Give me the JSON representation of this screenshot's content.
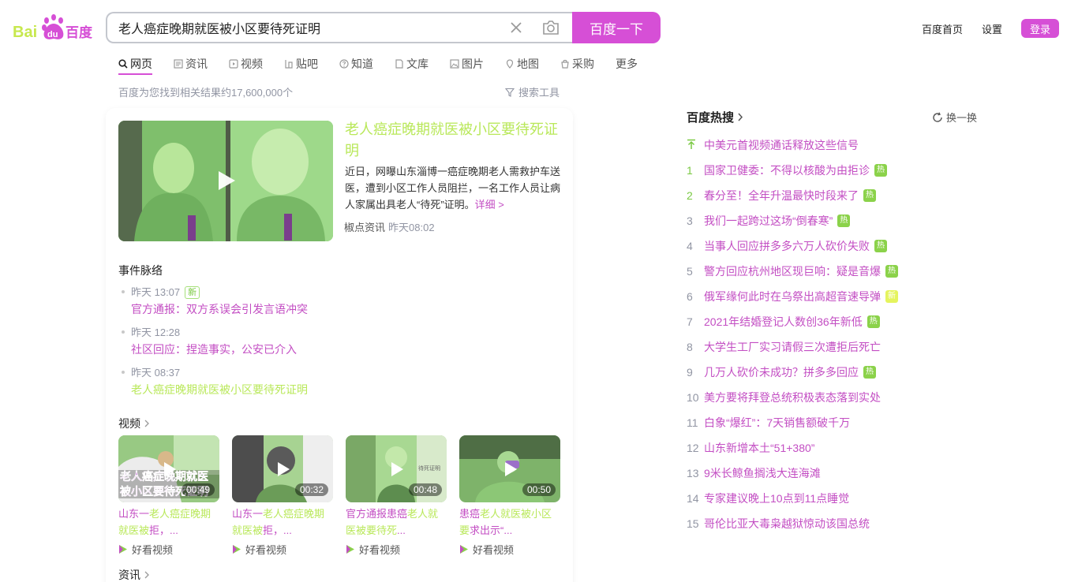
{
  "header": {
    "logo_text": "Bai du 百度",
    "search_value": "老人癌症晚期就医被小区要待死证明",
    "search_button": "百度一下",
    "links": [
      "百度首页",
      "设置"
    ],
    "login": "登录",
    "accent_color": "#d64fd6"
  },
  "tabs": [
    {
      "label": "网页",
      "icon": "search-icon"
    },
    {
      "label": "资讯",
      "icon": "news-icon"
    },
    {
      "label": "视频",
      "icon": "video-icon"
    },
    {
      "label": "贴吧",
      "icon": "tieba-icon"
    },
    {
      "label": "知道",
      "icon": "question-icon"
    },
    {
      "label": "文库",
      "icon": "document-icon"
    },
    {
      "label": "图片",
      "icon": "image-icon"
    },
    {
      "label": "地图",
      "icon": "map-icon"
    },
    {
      "label": "采购",
      "icon": "shopping-icon"
    },
    {
      "label": "更多",
      "icon": ""
    }
  ],
  "result_count": "百度为您找到相关结果约17,600,000个",
  "search_tools": "搜索工具",
  "news": {
    "title": "老人癌症晚期就医被小区要待死证明",
    "summary": "近日，网曝山东淄博一癌症晚期老人需救护车送医，遭到小区工作人员阻拦，一名工作人员让病人家属出具老人“待死”证明。",
    "more": "详细 >",
    "source": "椒点资讯",
    "time": "昨天08:02"
  },
  "timeline": {
    "title": "事件脉络",
    "items": [
      {
        "time": "昨天 13:07",
        "badge": "新",
        "text": "官方通报：双方系误会引发言语冲突"
      },
      {
        "time": "昨天 12:28",
        "badge": "",
        "text": "社区回应：捏造事实，公安已介入"
      },
      {
        "time": "昨天 08:37",
        "badge": "",
        "text": "老人癌症晚期就医被小区要待死证明"
      }
    ]
  },
  "videos": {
    "title": "视频",
    "items": [
      {
        "duration": "00:49",
        "t1": "山东一",
        "t2": "老人癌症晚期就医被",
        "t3": "拒，...",
        "source": "好看视频",
        "overlay": "老人癌症晚期就医被小区要待死证明"
      },
      {
        "duration": "00:32",
        "t1": "山东一",
        "t2": "老人癌症晚期就医被",
        "t3": "拒，...",
        "source": "好看视频"
      },
      {
        "duration": "00:48",
        "t1": "官方通报患癌",
        "t2": "老人就医被要待死",
        "t3": "...",
        "source": "好看视频"
      },
      {
        "duration": "00:50",
        "t1": "患癌",
        "t2": "老人就医被小区要",
        "t3": "求出示“...",
        "source": "好看视频"
      }
    ]
  },
  "next_section": "资讯",
  "hot": {
    "title": "百度热搜",
    "refresh": "换一换",
    "items": [
      {
        "rank": "",
        "text": "中美元首视频通话释放这些信号",
        "badge": ""
      },
      {
        "rank": "1",
        "text": "国家卫健委：不得以核酸为由拒诊",
        "badge": "热"
      },
      {
        "rank": "2",
        "text": "春分至！全年升温最快时段来了",
        "badge": "热"
      },
      {
        "rank": "3",
        "text": "我们一起跨过这场“倒春寒”",
        "badge": "热"
      },
      {
        "rank": "4",
        "text": "当事人回应拼多多六万人砍价失败",
        "badge": "热"
      },
      {
        "rank": "5",
        "text": "警方回应杭州地区现巨响：疑是音爆",
        "badge": "热"
      },
      {
        "rank": "6",
        "text": "俄军缘何此时在乌祭出高超音速导弹",
        "badge": "新"
      },
      {
        "rank": "7",
        "text": "2021年结婚登记人数创36年新低",
        "badge": "热"
      },
      {
        "rank": "8",
        "text": "大学生工厂实习请假三次遭拒后死亡",
        "badge": ""
      },
      {
        "rank": "9",
        "text": "几万人砍价未成功？拼多多回应",
        "badge": "热"
      },
      {
        "rank": "10",
        "text": "美方要将拜登总统积极表态落到实处",
        "badge": ""
      },
      {
        "rank": "11",
        "text": "白象“爆红”：7天销售额破千万",
        "badge": ""
      },
      {
        "rank": "12",
        "text": "山东新增本土“51+380”",
        "badge": ""
      },
      {
        "rank": "13",
        "text": "9米长鲸鱼搁浅大连海滩",
        "badge": ""
      },
      {
        "rank": "14",
        "text": "专家建议晚上10点到11点睡觉",
        "badge": ""
      },
      {
        "rank": "15",
        "text": "哥伦比亚大毒枭越狱惊动该国总统",
        "badge": ""
      }
    ]
  }
}
